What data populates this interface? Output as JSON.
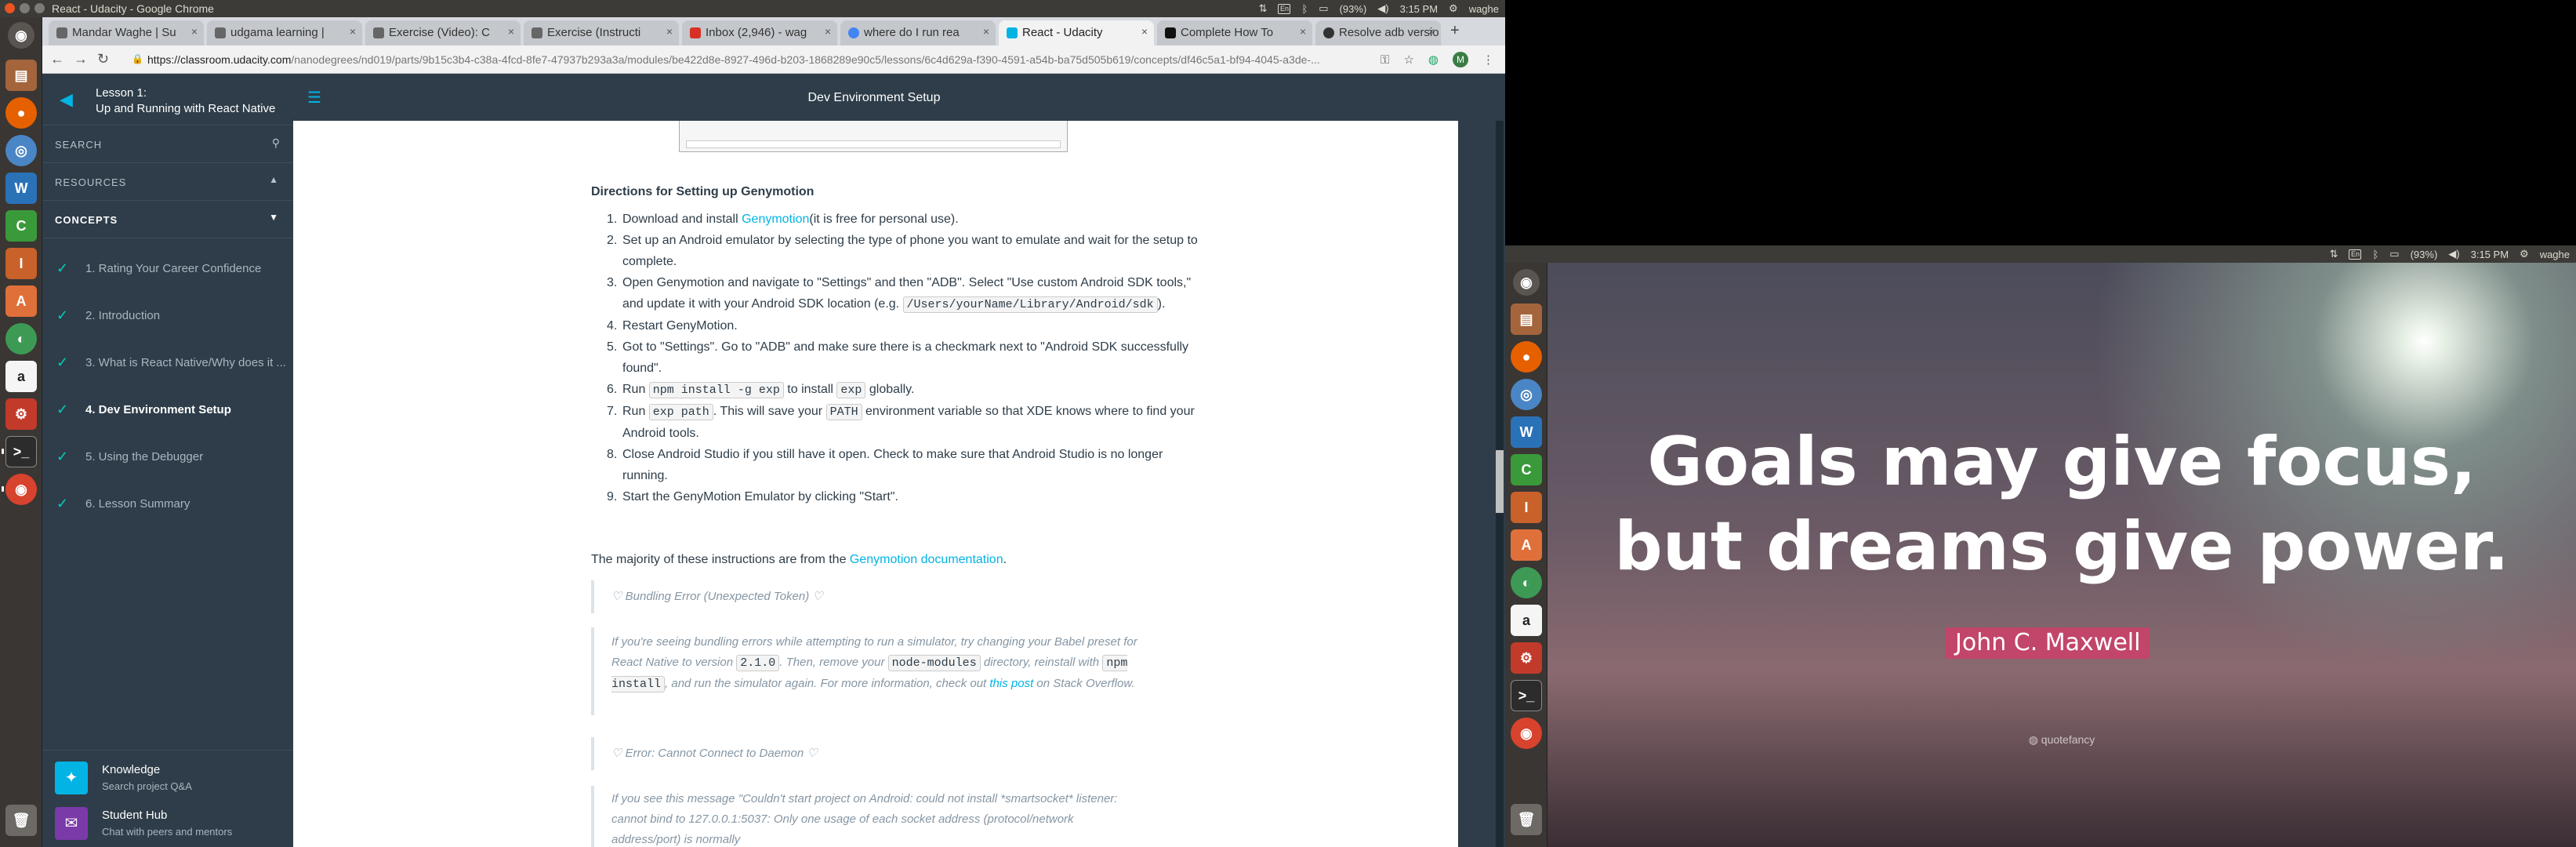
{
  "left_screen": {
    "window_title": "React - Udacity - Google Chrome",
    "tray": {
      "battery": "(93%)",
      "time": "3:15 PM",
      "user": "waghe"
    },
    "launcher_icons": [
      "dash-icon",
      "files-icon",
      "firefox-icon",
      "chromium-icon",
      "libreoffice-writer-icon",
      "libreoffice-calc-icon",
      "libreoffice-impress-icon",
      "ubuntu-software-icon",
      "app-icon",
      "amazon-icon",
      "settings-icon",
      "terminal-icon",
      "chrome-icon",
      "trash-icon"
    ]
  },
  "browser": {
    "tabs": [
      {
        "label": "Mandar Waghe | Su",
        "active": false
      },
      {
        "label": "udgama learning |",
        "active": false
      },
      {
        "label": "Exercise (Video): C",
        "active": false
      },
      {
        "label": "Exercise (Instructi",
        "active": false
      },
      {
        "label": "Inbox (2,946) - wag",
        "active": false
      },
      {
        "label": "where do I run rea",
        "active": false
      },
      {
        "label": "React - Udacity",
        "active": true
      },
      {
        "label": "Complete How To",
        "active": false
      },
      {
        "label": "Resolve adb versio",
        "active": false
      }
    ],
    "url_prefix": "https://classroom.udacity.com",
    "url_rest": "/nanodegrees/nd019/parts/9b15c3b4-c38a-4fcd-8fe7-47937b293a3a/modules/be422d8e-8927-496d-b203-1868289e90c5/lessons/6c4d629a-f390-4591-a54b-ba75d505b619/concepts/df46c5a1-bf94-4045-a3de-...",
    "profile_initial": "M"
  },
  "udacity": {
    "lesson_label": "Lesson 1:",
    "lesson_title": "Up and Running with React Native",
    "search_label": "SEARCH",
    "resources_label": "RESOURCES",
    "concepts_label": "CONCEPTS",
    "concepts": [
      {
        "label": "1. Rating Your Career Confidence",
        "done": true,
        "current": false
      },
      {
        "label": "2. Introduction",
        "done": true,
        "current": false
      },
      {
        "label": "3. What is React Native/Why does it ...",
        "done": true,
        "current": false
      },
      {
        "label": "4. Dev Environment Setup",
        "done": true,
        "current": true
      },
      {
        "label": "5. Using the Debugger",
        "done": true,
        "current": false
      },
      {
        "label": "6. Lesson Summary",
        "done": true,
        "current": false
      }
    ],
    "footer": {
      "knowledge_title": "Knowledge",
      "knowledge_sub": "Search project Q&A",
      "hub_title": "Student Hub",
      "hub_sub": "Chat with peers and mentors"
    },
    "page_title": "Dev Environment Setup",
    "heading": "Directions for Setting up Genymotion",
    "steps": {
      "s1a": "Download and install ",
      "s1link": "Genymotion",
      "s1b": "(it is free for personal use).",
      "s2": "Set up an Android emulator by selecting the type of phone you want to emulate and wait for the setup to complete.",
      "s3": "Open Genymotion and navigate to \"Settings\" and then \"ADB\". Select \"Use custom Android SDK tools,\" and update it with your Android SDK location (e.g. ",
      "s3code": "/Users/yourName/Library/Android/sdk",
      "s3end": ").",
      "s4": "Restart GenyMotion.",
      "s5": "Got to \"Settings\". Go to \"ADB\" and make sure there is a checkmark next to \"Android SDK successfully found\".",
      "s6a": "Run ",
      "s6code1": "npm install -g exp",
      "s6b": " to install ",
      "s6code2": "exp",
      "s6c": " globally.",
      "s7a": "Run ",
      "s7code1": "exp path",
      "s7b": ". This will save your ",
      "s7code2": "PATH",
      "s7c": " environment variable so that XDE knows where to find your Android tools.",
      "s8": "Close Android Studio if you still have it open. Check to make sure that Android Studio is no longer running.",
      "s9": "Start the GenyMotion Emulator by clicking \"Start\"."
    },
    "para_a": "The majority of these instructions are from the ",
    "para_link": "Genymotion documentation",
    "para_b": ".",
    "callout1_title": "Bundling Error (Unexpected Token)",
    "callout2": {
      "a": "If you're seeing bundling errors while attempting to run a simulator, try changing your Babel preset for React Native to version ",
      "code1": "2.1.0",
      "b": ". Then, remove your ",
      "code2": "node-modules",
      "c": " directory, reinstall with ",
      "code3": "npm install",
      "d": ", and run the simulator again. For more information, check out ",
      "link": "this post",
      "e": " on Stack Overflow."
    },
    "callout3_title": "Error: Cannot Connect to Daemon",
    "callout4": "If you see this message \"Couldn't start project on Android: could not install *smartsocket* listener: cannot bind to 127.0.0.1:5037: Only one usage of each socket address (protocol/network address/port) is normally"
  },
  "right_screen": {
    "tray": {
      "battery": "(93%)",
      "time": "3:15 PM",
      "user": "waghe"
    },
    "quote_line1": "Goals may give focus,",
    "quote_line2": "but dreams give power.",
    "author": "John C. Maxwell",
    "brand": "quotefancy"
  },
  "colors": {
    "udacity_navy": "#2e3d49",
    "udacity_cyan": "#02b3e4",
    "check_teal": "#02ccba",
    "ubuntu_panel": "#3c3b37",
    "author_pink": "#c2456a"
  }
}
